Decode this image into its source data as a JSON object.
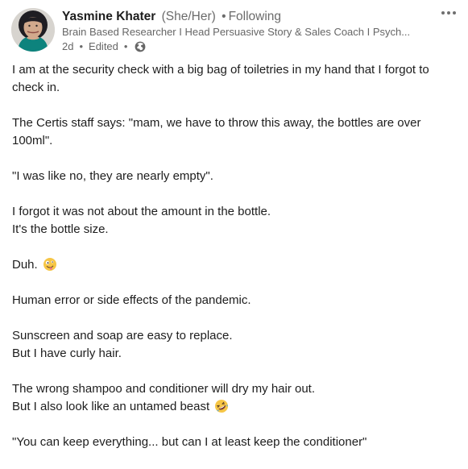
{
  "author": {
    "name": "Yasmine Khater",
    "pronouns": "(She/Her)",
    "relationship": "Following",
    "headline": "Brain Based Researcher I Head Persuasive Story & Sales Coach I Psych...",
    "time": "2d",
    "edited": "Edited",
    "visibility_icon": "globe-icon",
    "avatar_icon": "profile-photo"
  },
  "header": {
    "separator": "•",
    "more_icon": "more-options-icon"
  },
  "post": {
    "paragraphs": [
      {
        "lines": [
          "I am at the security check with a big bag of toiletries in my hand that I forgot to check in."
        ]
      },
      {
        "lines": [
          "The Certis staff says: \"mam, we have to throw this away, the bottles are over 100ml\"."
        ]
      },
      {
        "lines": [
          "\"I was like no, they are nearly empty\"."
        ]
      },
      {
        "lines": [
          "I forgot it was not about the amount in the bottle.",
          "It's the bottle size."
        ]
      },
      {
        "lines": [
          "Duh."
        ],
        "emoji": "zany-face-emoji"
      },
      {
        "lines": [
          "Human error or side effects of the pandemic."
        ]
      },
      {
        "lines": [
          "Sunscreen and soap are easy to replace.",
          "But I have curly hair."
        ]
      },
      {
        "lines": [
          "The wrong shampoo and conditioner will dry my hair out.",
          "But I also look like an untamed beast"
        ],
        "emoji": "rolling-laughing-emoji"
      },
      {
        "lines": [
          "\"You can keep everything... but can I at least keep the conditioner\""
        ]
      }
    ]
  },
  "colors": {
    "text": "#1d1d1d",
    "secondary_text": "#666666",
    "background": "#ffffff"
  }
}
